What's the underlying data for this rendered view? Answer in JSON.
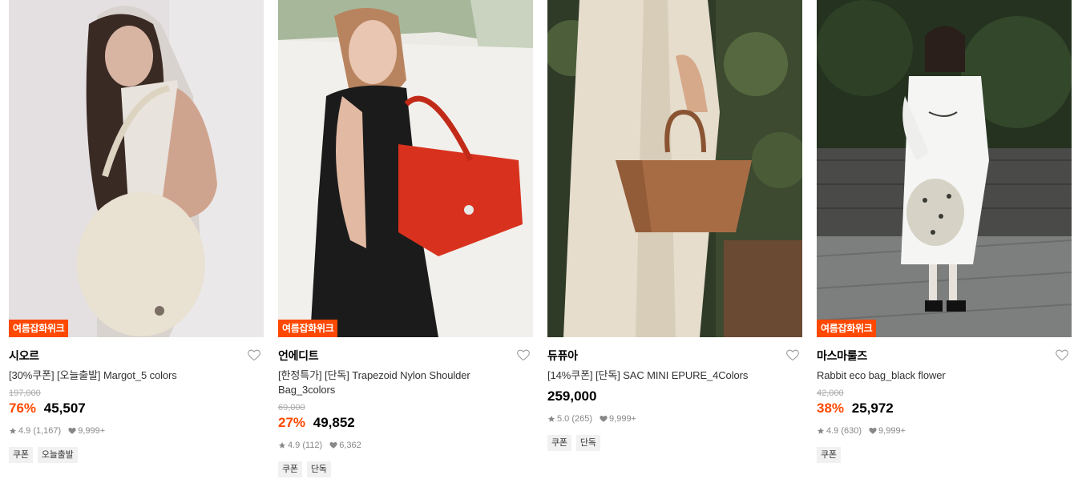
{
  "products": [
    {
      "brand": "시오르",
      "name": "[30%쿠폰] [오늘출발] Margot_5 colors",
      "badge": "여름잡화위크",
      "original_price": "197,000",
      "discount": "76%",
      "price": "45,507",
      "rating": "4.9 (1,167)",
      "likes": "9,999+",
      "tags": [
        "쿠폰",
        "오늘출발"
      ]
    },
    {
      "brand": "언에디트",
      "name": "[한정특가] [단독] Trapezoid Nylon Shoulder Bag_3colors",
      "badge": "여름잡화위크",
      "original_price": "69,000",
      "discount": "27%",
      "price": "49,852",
      "rating": "4.9 (112)",
      "likes": "6,362",
      "tags": [
        "쿠폰",
        "단독"
      ]
    },
    {
      "brand": "듀퓨아",
      "name": "[14%쿠폰] [단독] SAC MINI EPURE_4Colors",
      "badge": "",
      "original_price": "",
      "discount": "",
      "price": "259,000",
      "rating": "5.0 (265)",
      "likes": "9,999+",
      "tags": [
        "쿠폰",
        "단독"
      ]
    },
    {
      "brand": "마스마룰즈",
      "name": "Rabbit eco bag_black flower",
      "badge": "여름잡화위크",
      "original_price": "42,000",
      "discount": "38%",
      "price": "25,972",
      "rating": "4.9 (630)",
      "likes": "9,999+",
      "tags": [
        "쿠폰"
      ]
    }
  ],
  "icons": {
    "like": "heart-outline-icon",
    "star": "star-icon",
    "heart": "heart-filled-icon"
  },
  "colors": {
    "accent": "#ff4800",
    "muted": "#888888",
    "tag_bg": "#f1f1f1"
  }
}
